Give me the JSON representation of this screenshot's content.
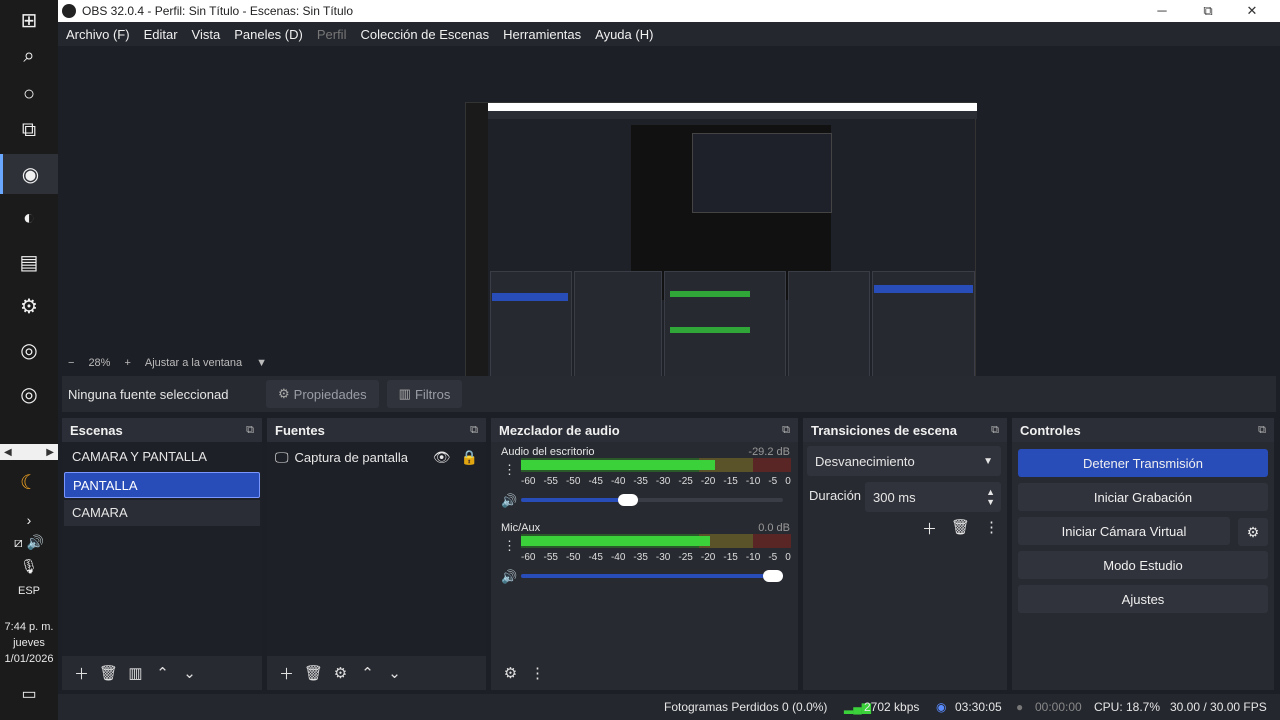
{
  "window": {
    "title": "OBS 32.0.4 - Perfil: Sin Título - Escenas: Sin Título",
    "minimize": "─",
    "maximize": "⧉",
    "close": "✕"
  },
  "menu": [
    "Archivo (F)",
    "Editar",
    "Vista",
    "Paneles (D)",
    "Perfil",
    "Colección de Escenas",
    "Herramientas",
    "Ayuda (H)"
  ],
  "menu_disabled_index": 4,
  "zoom": {
    "minus": "−",
    "value": "28%",
    "plus": "+",
    "fit": "Ajustar a la ventana",
    "dropdown": "▼"
  },
  "context": {
    "no_source": "Ninguna fuente seleccionad",
    "properties": "Propiedades",
    "filters": "Filtros"
  },
  "scenes": {
    "title": "Escenas",
    "items": [
      "CAMARA Y PANTALLA",
      "PANTALLA",
      "CAMARA"
    ],
    "selected_index": 1,
    "hover_index": 2
  },
  "sources": {
    "title": "Fuentes",
    "items": [
      {
        "name": "Captura de pantalla",
        "icon": "monitor-icon"
      }
    ]
  },
  "mixer": {
    "title": "Mezclador de audio",
    "tracks": [
      {
        "name": "Audio del escritorio",
        "db": "-29.2 dB",
        "level": 0.72,
        "volume": 0.4
      },
      {
        "name": "Mic/Aux",
        "db": "0.0 dB",
        "level": 0.7,
        "volume": 1.0
      }
    ],
    "ticks": [
      "-60",
      "-55",
      "-50",
      "-45",
      "-40",
      "-35",
      "-30",
      "-25",
      "-20",
      "-15",
      "-10",
      "-5",
      "0"
    ]
  },
  "transitions": {
    "title": "Transiciones de escena",
    "selected": "Desvanecimiento",
    "duration_label": "Duración",
    "duration": "300 ms"
  },
  "controls": {
    "title": "Controles",
    "buttons": [
      "Detener Transmisión",
      "Iniciar Grabación",
      "Iniciar Cámara Virtual",
      "Modo Estudio",
      "Ajustes"
    ]
  },
  "status": {
    "dropped": "Fotogramas Perdidos 0 (0.0%)",
    "bitrate": "2702 kbps",
    "stream_time": "03:30:05",
    "rec_time": "00:00:00",
    "cpu": "CPU: 18.7%",
    "fps": "30.00 / 30.00 FPS"
  },
  "taskbar": {
    "time": "7:44 p. m.",
    "day": "jueves",
    "date": "1/01/2026",
    "lang": "ESP"
  },
  "colors": {
    "accent": "#284cb8",
    "meter_green": "#3bd13b",
    "bg": "#1d1f26"
  }
}
